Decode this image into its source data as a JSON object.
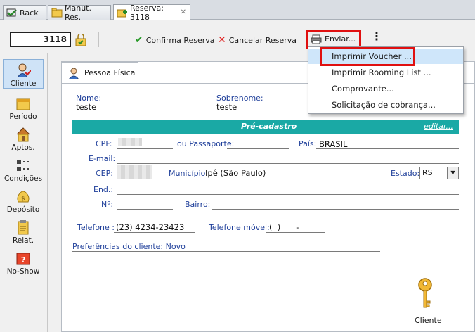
{
  "tabs": [
    {
      "label": "Rack",
      "icon": "rack-icon"
    },
    {
      "label": "Manut. Res.",
      "icon": "folder-icon"
    },
    {
      "label": "Reserva: 3118",
      "icon": "reservation-icon",
      "active": true
    }
  ],
  "toolbar": {
    "reservation_number": "3118",
    "confirm_label": "Confirma Reserva",
    "cancel_label": "Cancelar Reserva",
    "send_label": "Enviar..."
  },
  "send_menu": {
    "items": [
      "Imprimir Voucher ...",
      "Imprimir Rooming List ...",
      "Comprovante...",
      "Solicitação de cobrança..."
    ]
  },
  "sidebar": {
    "items": [
      "Cliente",
      "Período",
      "Aptos.",
      "Condições",
      "Depósito",
      "Relat.",
      "No-Show"
    ]
  },
  "person_tab": "Pessoa Física",
  "form": {
    "nome_label": "Nome:",
    "nome_value": "teste",
    "sobrenome_label": "Sobrenome:",
    "sobrenome_value": "teste",
    "section_title": "Pré-cadastro",
    "edit_link": "editar...",
    "cpf_label": "CPF:",
    "passaporte_label": "ou Passaporte:",
    "pais_label": "País:",
    "pais_value": "BRASIL",
    "email_label": "E-mail:",
    "cep_label": "CEP:",
    "municipio_label": "Município:",
    "municipio_value": "Ipê (São Paulo)",
    "estado_label": "Estado:",
    "estado_value": "RS",
    "end_label": "End.:",
    "numero_label": "Nº:",
    "bairro_label": "Bairro:",
    "telefone_label": "Telefone :",
    "telefone_value": "(23) 4234-23423",
    "telefone_movel_label": "Telefone móvel:",
    "telefone_movel_value": "(  )      -",
    "preferencias_label": "Preferências do cliente:",
    "preferencias_link": "Novo"
  },
  "client_key_label": "Cliente",
  "colors": {
    "accent_bar": "#1aa9a5",
    "label_blue": "#1f3f9a",
    "highlight_red": "#e01010",
    "menu_highlight": "#cfe6fa"
  }
}
